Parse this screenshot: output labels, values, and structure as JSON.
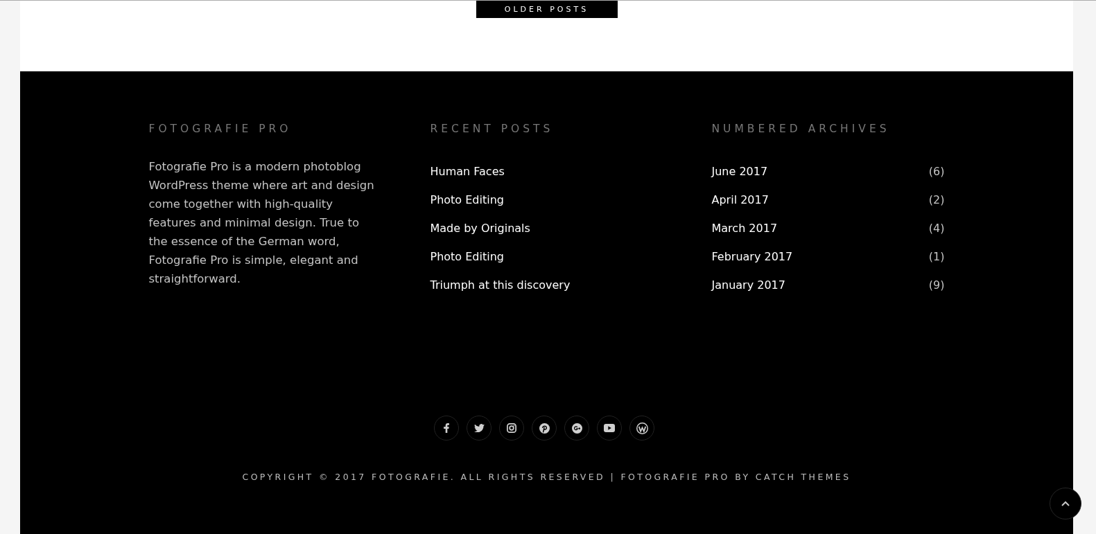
{
  "pagination": {
    "button": "OLDER POSTS"
  },
  "footer": {
    "widgets": [
      {
        "kind": "text",
        "title": "FOTOGRAFIE PRO",
        "text": "Fotografie Pro is a modern photoblog WordPress theme where art and design come together with high-quality features and minimal design. True to the essence of the German word, Fotografie Pro is simple, elegant and straightforward."
      },
      {
        "kind": "links",
        "title": "RECENT POSTS",
        "items": [
          {
            "label": "Human Faces"
          },
          {
            "label": "Photo Editing"
          },
          {
            "label": "Made by Originals"
          },
          {
            "label": "Photo Editing"
          },
          {
            "label": "Triumph at this discovery"
          }
        ]
      },
      {
        "kind": "archives",
        "title": "NUMBERED ARCHIVES",
        "items": [
          {
            "label": "June 2017",
            "count": "(6)"
          },
          {
            "label": "April 2017",
            "count": "(2)"
          },
          {
            "label": "March 2017",
            "count": "(4)"
          },
          {
            "label": "February 2017",
            "count": "(1)"
          },
          {
            "label": "January 2017",
            "count": "(9)"
          }
        ]
      }
    ],
    "social_links": [
      {
        "kind": "facebook"
      },
      {
        "kind": "twitter"
      },
      {
        "kind": "instagram"
      },
      {
        "kind": "pinterest"
      },
      {
        "kind": "google-plus"
      },
      {
        "kind": "youtube"
      },
      {
        "kind": "wordpress"
      }
    ],
    "copyright": "COPYRIGHT © 2017 FOTOGRAFIE. ALL RIGHTS RESERVED | FOTOGRAFIE PRO BY CATCH THEMES"
  }
}
